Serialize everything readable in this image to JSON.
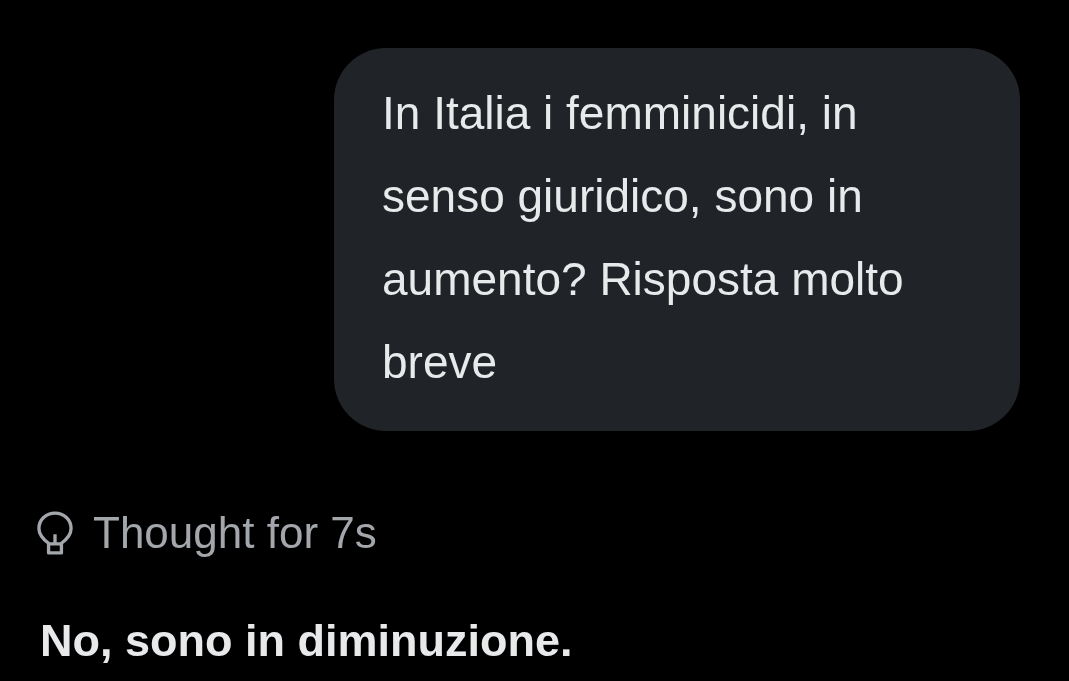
{
  "user_message": {
    "text": "In Italia i femminicidi, in senso giuridico, sono in aumento? Risposta molto breve"
  },
  "thought": {
    "label": "Thought for 7s"
  },
  "answer": {
    "text": "No, sono in diminuzione."
  }
}
